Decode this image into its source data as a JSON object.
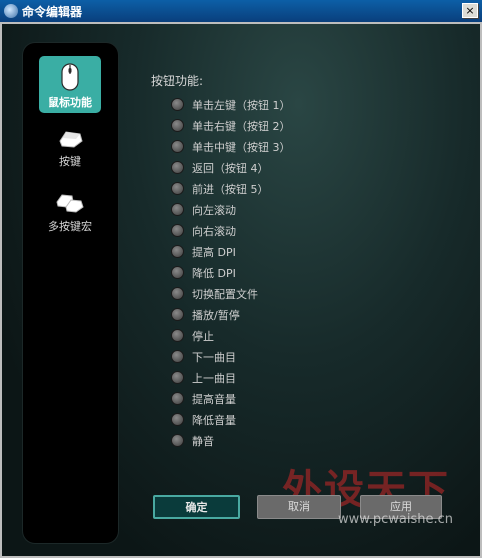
{
  "window": {
    "title": "命令编辑器",
    "close_label": "×"
  },
  "sidebar": {
    "items": [
      {
        "label": "鼠标功能",
        "icon": "mouse-icon",
        "active": true
      },
      {
        "label": "按键",
        "icon": "key-icon",
        "active": false
      },
      {
        "label": "多按键宏",
        "icon": "multi-key-icon",
        "active": false
      }
    ]
  },
  "content": {
    "title": "按钮功能:",
    "options": [
      "单击左键（按钮 1）",
      "单击右键（按钮 2）",
      "单击中键（按钮 3）",
      "返回（按钮 4）",
      "前进（按钮 5）",
      "向左滚动",
      "向右滚动",
      "提高 DPI",
      "降低 DPI",
      "切换配置文件",
      "播放/暂停",
      "停止",
      "下一曲目",
      "上一曲目",
      "提高音量",
      "降低音量",
      "静音"
    ]
  },
  "buttons": {
    "ok": "确定",
    "cancel": "取消",
    "apply": "应用"
  },
  "watermark": {
    "text": "外设天下",
    "url": "www.pcwaishe.cn"
  },
  "colors": {
    "accent": "#3aaea4",
    "titlebar": "#0c5fa7"
  }
}
